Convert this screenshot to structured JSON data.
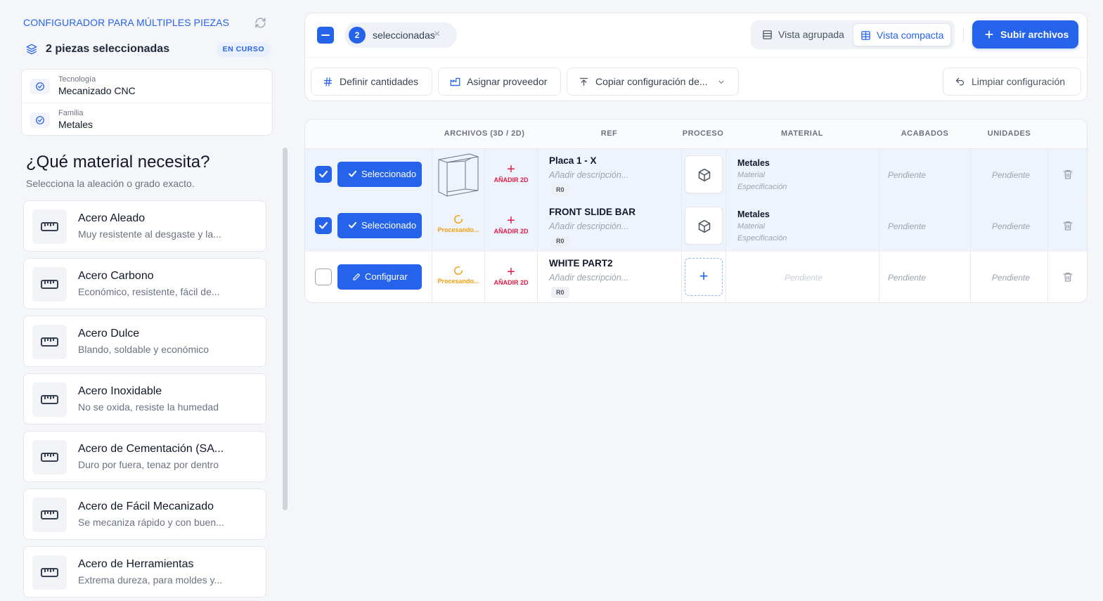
{
  "sidebar": {
    "title": "CONFIGURADOR PARA MÚLTIPLES PIEZAS",
    "selected_text": "2 piezas seleccionadas",
    "status_badge": "EN CURSO",
    "summary": [
      {
        "label": "Tecnología",
        "value": "Mecanizado CNC"
      },
      {
        "label": "Familia",
        "value": "Metales"
      }
    ],
    "question": "¿Qué material necesita?",
    "question_sub": "Selecciona la aleación o grado exacto.",
    "materials": [
      {
        "name": "Acero Aleado",
        "desc": "Muy resistente al desgaste y la..."
      },
      {
        "name": "Acero Carbono",
        "desc": "Económico, resistente, fácil de..."
      },
      {
        "name": "Acero Dulce",
        "desc": "Blando, soldable y económico"
      },
      {
        "name": "Acero Inoxidable",
        "desc": "No se oxida, resiste la humedad"
      },
      {
        "name": "Acero de Cementación (SA...",
        "desc": "Duro por fuera, tenaz por dentro"
      },
      {
        "name": "Acero de Fácil Mecanizado",
        "desc": "Se mecaniza rápido y con buen..."
      },
      {
        "name": "Acero de Herramientas",
        "desc": "Extrema dureza, para moldes y..."
      }
    ]
  },
  "toolbar": {
    "selected_count": "2",
    "selected_label": "seleccionadas",
    "close_symbol": "×",
    "view_grouped": "Vista agrupada",
    "view_compact": "Vista compacta",
    "upload_label": "Subir archivos",
    "actions": {
      "quantities": "Definir cantidades",
      "provider": "Asignar proveedor",
      "copy_config": "Copiar configuración de...",
      "clear_config": "Limpiar configuración"
    }
  },
  "table": {
    "headers": {
      "files": "ARCHIVOS (3D / 2D)",
      "ref": "REF",
      "process": "PROCESO",
      "material": "MATERIAL",
      "finishes": "ACABADOS",
      "units": "UNIDADES"
    },
    "add_2d_label": "AÑADIR 2D",
    "add_2d_symbol": "+",
    "add_process_symbol": "+",
    "rows": [
      {
        "state_label": "Seleccionado",
        "ref_name": "Placa 1 - X",
        "ref_desc": "Añadir descripción...",
        "revision": "R0",
        "material": "Metales",
        "material_sub": "Material",
        "spec_sub": "Especificación",
        "finishes": "Pendiente",
        "units": "Pendiente"
      },
      {
        "state_label": "Seleccionado",
        "file_status": "Procesando...",
        "ref_name": "FRONT SLIDE BAR",
        "ref_desc": "Añadir descripción...",
        "revision": "R0",
        "material": "Metales",
        "material_sub": "Material",
        "spec_sub": "Especificación",
        "finishes": "Pendiente",
        "units": "Pendiente"
      },
      {
        "state_label": "Configurar",
        "file_status": "Procesando...",
        "ref_name": "WHITE PART2",
        "ref_desc": "Añadir descripción...",
        "revision": "R0",
        "material": "Pendiente",
        "finishes": "Pendiente",
        "units": "Pendiente"
      }
    ]
  },
  "colors": {
    "primary": "#2563eb",
    "processing": "#f59e0b",
    "add_2d": "#e11d48",
    "selected_row_bg": "#eef4fe"
  }
}
